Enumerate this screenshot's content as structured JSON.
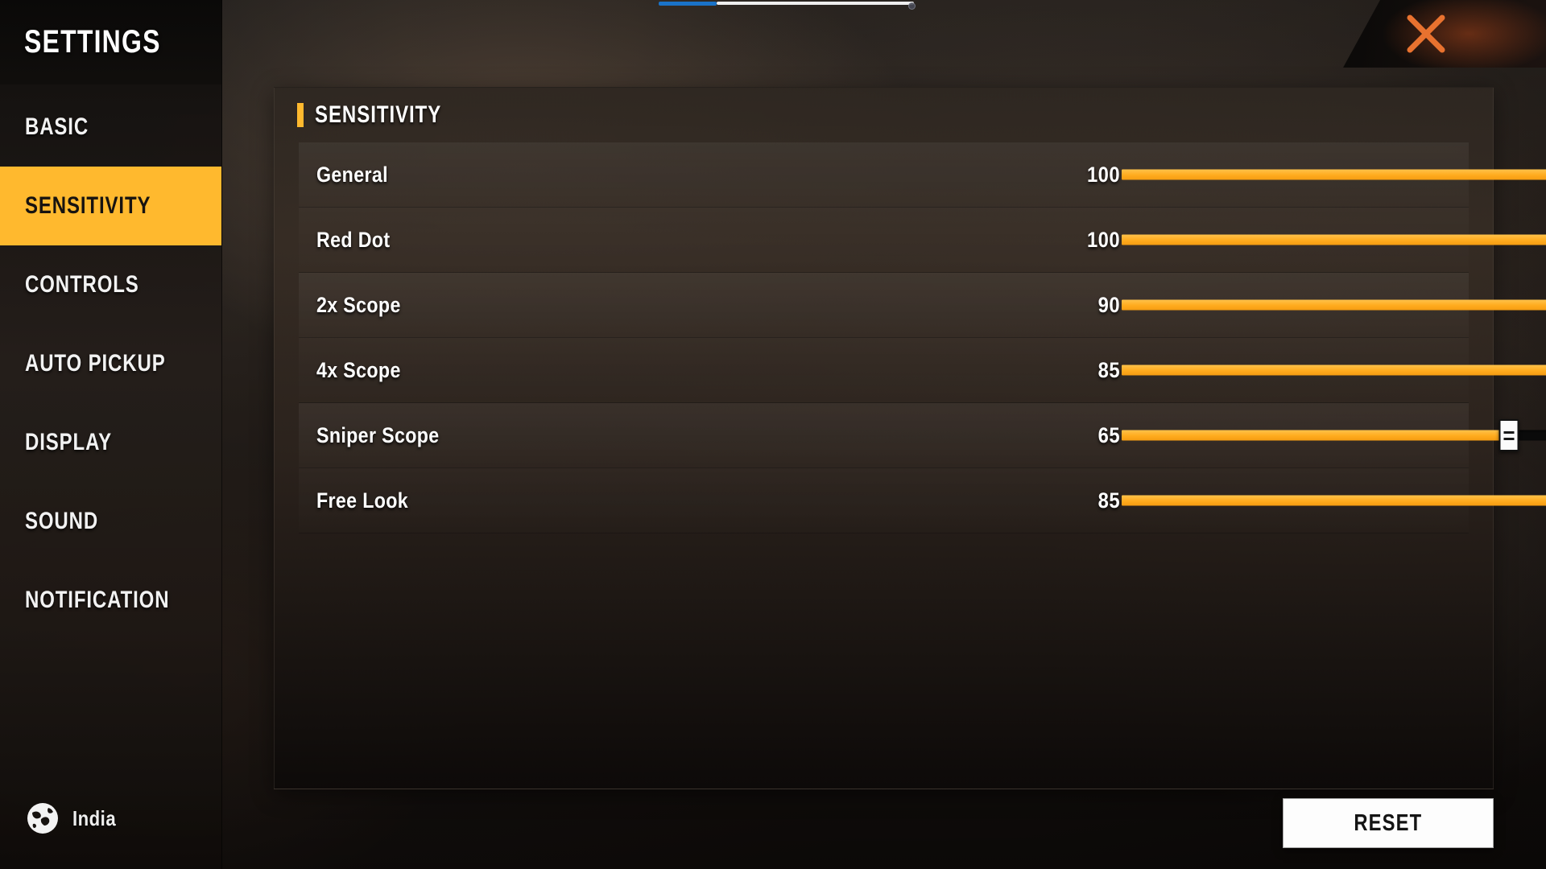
{
  "colors": {
    "accent": "#FFB92E",
    "slider_fill": "#FFAB1E",
    "track": "#0A0A0A",
    "close_x": "#E8722F",
    "active_text": "#171310",
    "panel_text": "#FFFFFF",
    "scrub_fill": "#1A73C8"
  },
  "top_overlay": {
    "name": "video-scrubber",
    "fill_color": "#1A73C8",
    "track_color": "#EFEFEF"
  },
  "close_button": {
    "icon": "close-icon",
    "label": "X"
  },
  "sidebar": {
    "title": "SETTINGS",
    "items": [
      {
        "label": "BASIC",
        "active": false
      },
      {
        "label": "SENSITIVITY",
        "active": true
      },
      {
        "label": "CONTROLS",
        "active": false
      },
      {
        "label": "AUTO PICKUP",
        "active": false
      },
      {
        "label": "DISPLAY",
        "active": false
      },
      {
        "label": "SOUND",
        "active": false
      },
      {
        "label": "NOTIFICATION",
        "active": false
      }
    ],
    "region": {
      "icon": "globe-icon",
      "name": "India"
    }
  },
  "panel": {
    "header": "SENSITIVITY",
    "rows": [
      {
        "label": "General",
        "value": "100",
        "percent": 100
      },
      {
        "label": "Red Dot",
        "value": "100",
        "percent": 100
      },
      {
        "label": "2x Scope",
        "value": "90",
        "percent": 90
      },
      {
        "label": "4x Scope",
        "value": "85",
        "percent": 85
      },
      {
        "label": "Sniper Scope",
        "value": "65",
        "percent": 65
      },
      {
        "label": "Free Look",
        "value": "85",
        "percent": 85
      }
    ],
    "slider_range": {
      "min": 0,
      "max": 100
    }
  },
  "footer": {
    "reset_label": "RESET"
  }
}
